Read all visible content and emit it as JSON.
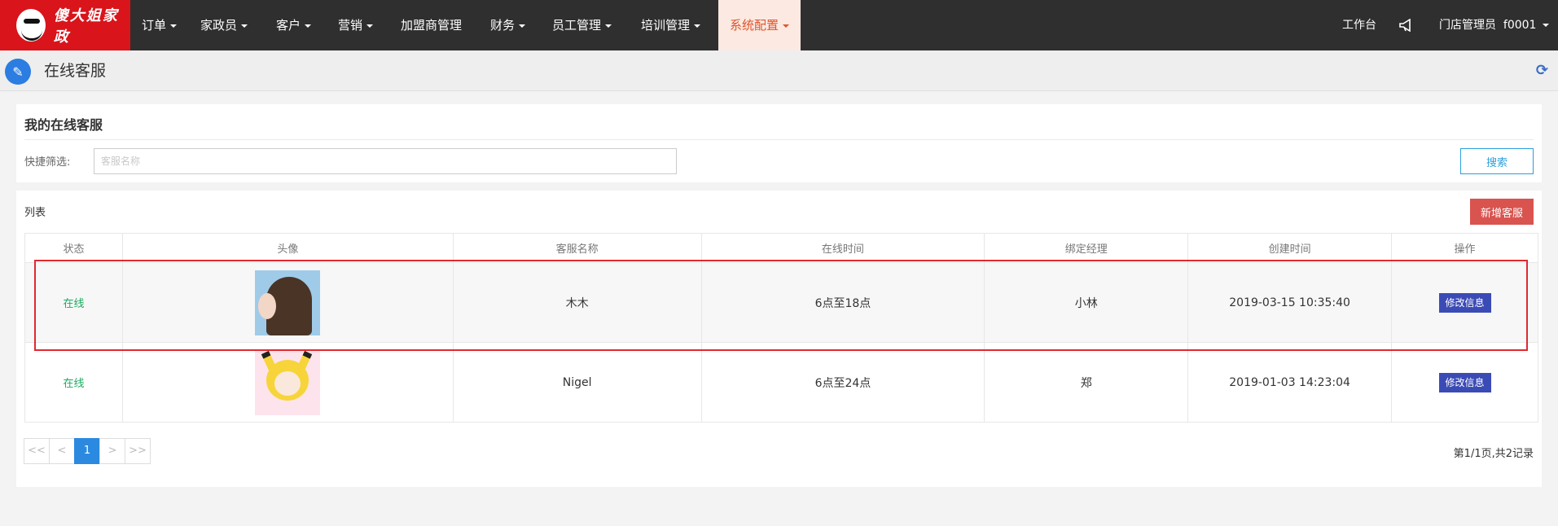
{
  "brand": {
    "name": "傻大姐家政",
    "logo_icon": "mascot-face-icon",
    "color": "#d9141b"
  },
  "nav": {
    "items": [
      {
        "label": "订单",
        "dropdown": true
      },
      {
        "label": "家政员",
        "dropdown": true
      },
      {
        "label": "客户",
        "dropdown": true
      },
      {
        "label": "营销",
        "dropdown": true
      },
      {
        "label": "加盟商管理",
        "dropdown": false
      },
      {
        "label": "财务",
        "dropdown": true
      },
      {
        "label": "员工管理",
        "dropdown": true
      },
      {
        "label": "培训管理",
        "dropdown": true
      },
      {
        "label": "系统配置",
        "dropdown": true,
        "active": true
      }
    ],
    "right": {
      "workbench": "工作台",
      "notify_icon": "megaphone-icon",
      "user": "门店管理员  f0001"
    }
  },
  "page": {
    "title": "在线客服",
    "title_icon": "pencil-icon",
    "refresh_icon": "refresh-icon"
  },
  "filter": {
    "section_title": "我的在线客服",
    "quick_filter_label": "快捷筛选:",
    "name_placeholder": "客服名称",
    "search_label": "搜索"
  },
  "list": {
    "label": "列表",
    "add_label": "新增客服",
    "columns": [
      "状态",
      "头像",
      "客服名称",
      "在线时间",
      "绑定经理",
      "创建时间",
      "操作"
    ],
    "rows": [
      {
        "status": "在线",
        "avatar": "anime-girl-avatar",
        "name": "木木",
        "online_time": "6点至18点",
        "manager": "小林",
        "created": "2019-03-15 10:35:40",
        "action": "修改信息"
      },
      {
        "status": "在线",
        "avatar": "pikachu-costume-avatar",
        "name": "Nigel",
        "online_time": "6点至24点",
        "manager": "郑",
        "created": "2019-01-03 14:23:04",
        "action": "修改信息"
      }
    ]
  },
  "pagination": {
    "first": "<<",
    "prev": "<",
    "current": "1",
    "next": ">",
    "last": ">>",
    "info": "第1/1页,共2记录"
  },
  "colors": {
    "accent": "#2b8ae0",
    "status_online": "#1aab5f",
    "danger": "#d9534f",
    "highlight": "#e0292f"
  }
}
